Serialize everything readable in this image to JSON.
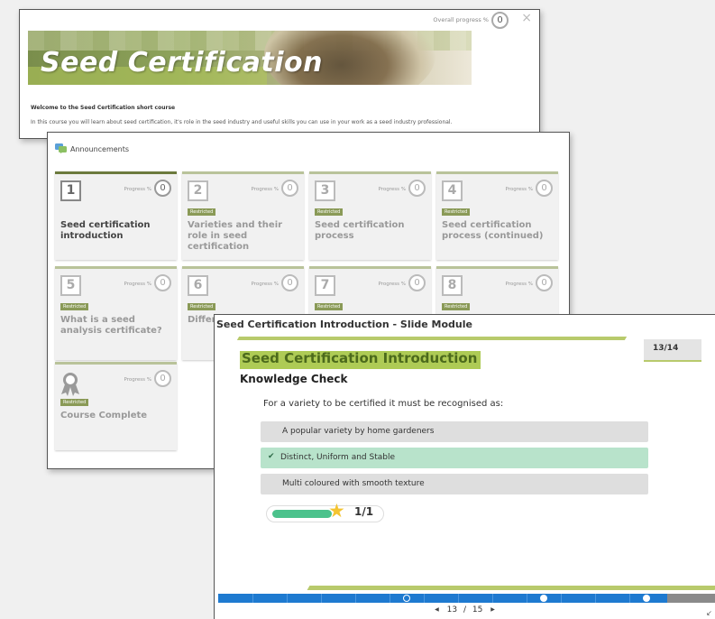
{
  "course_window": {
    "overall_progress_label": "Overall progress %",
    "overall_progress_value": "0",
    "close_icon": "×",
    "banner_title": "Seed Certification",
    "welcome_heading": "Welcome to the Seed Certification short course",
    "intro_text": "In this course you will learn about seed certification, it's role in the seed industry and useful skills you can use in your work as a seed industry professional."
  },
  "modules_window": {
    "announcements_label": "Announcements",
    "progress_label": "Progress %",
    "restricted_label": "Restricted",
    "cards": [
      {
        "num": "1",
        "title": "Seed certification introduction",
        "progress": "0",
        "restricted": false
      },
      {
        "num": "2",
        "title": "Varieties and their role in seed certification",
        "progress": "0",
        "restricted": true
      },
      {
        "num": "3",
        "title": "Seed certification process",
        "progress": "0",
        "restricted": true
      },
      {
        "num": "4",
        "title": "Seed certification process (continued)",
        "progress": "0",
        "restricted": true
      },
      {
        "num": "5",
        "title": "What is a seed analysis certificate?",
        "progress": "0",
        "restricted": true
      },
      {
        "num": "6",
        "title": "Differ analy",
        "progress": "0",
        "restricted": true
      },
      {
        "num": "7",
        "title": "",
        "progress": "0",
        "restricted": true
      },
      {
        "num": "8",
        "title": "",
        "progress": "0",
        "restricted": true
      },
      {
        "num": "",
        "title": "Course Complete",
        "progress": "0",
        "restricted": true,
        "icon": "ribbon-award-icon"
      }
    ]
  },
  "slide_window": {
    "title": "Seed Certification Introduction - Slide Module",
    "slide_title": "Seed Certification Introduction",
    "slide_subtitle": "Knowledge Check",
    "slide_counter": "13/14",
    "question": "For a variety to be certified it must be recognised as:",
    "options": [
      {
        "label": "A popular variety by home gardeners",
        "correct": false
      },
      {
        "label": "Distinct, Uniform and Stable",
        "correct": true
      },
      {
        "label": "Multi coloured with smooth texture",
        "correct": false
      }
    ],
    "score": "1/1",
    "quiz_progress_fraction": 1.0,
    "pager_current": "13",
    "pager_separator": "/",
    "pager_total": "15",
    "colors": {
      "accent_green": "#b8ca6c",
      "title_green": "#4c6a1c",
      "correct_bg": "#b8e3cb",
      "seek_blue": "#1e7ad0"
    }
  }
}
